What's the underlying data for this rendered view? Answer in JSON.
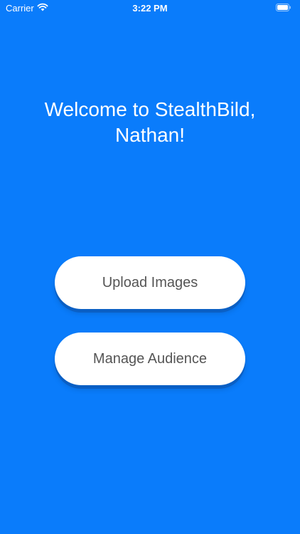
{
  "status_bar": {
    "carrier": "Carrier",
    "time": "3:22 PM",
    "wifi_icon": "wifi-icon",
    "battery_icon": "battery-icon"
  },
  "welcome": {
    "line1": "Welcome to StealthBild,",
    "line2": "Nathan!"
  },
  "actions": {
    "upload_label": "Upload Images",
    "audience_label": "Manage Audience"
  },
  "colors": {
    "background": "#0A7CFB",
    "button_bg": "#FFFFFF",
    "button_text": "#555555"
  }
}
